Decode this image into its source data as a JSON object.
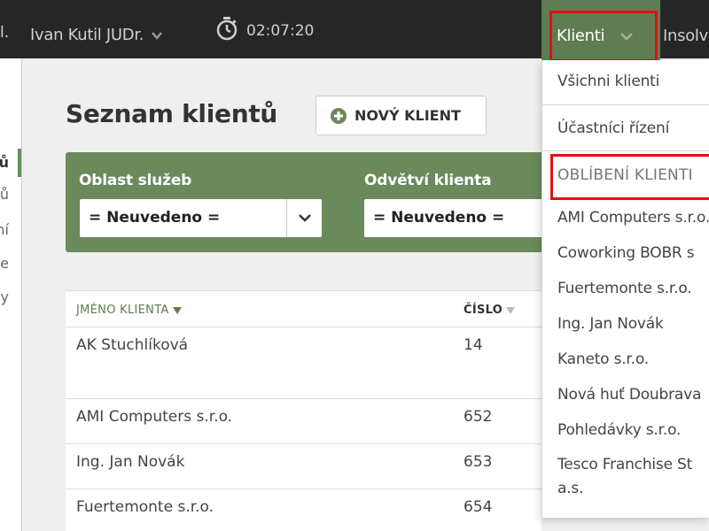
{
  "topbar": {
    "truncated_left": "l.",
    "user_name": "Ivan Kutil JUDr.",
    "timer": "02:07:20",
    "nav_klienti": "Klienti",
    "nav_next": "Insolv"
  },
  "sidebar": {
    "items": [
      "ů",
      "ů",
      "ní",
      "e",
      "y"
    ],
    "active_index": 0
  },
  "main": {
    "title": "Seznam klientů",
    "new_client_button": "NOVÝ KLIENT",
    "filters": [
      {
        "label": "Oblast služeb",
        "value": "= Neuvedeno ="
      },
      {
        "label": "Odvětví klienta",
        "value": "= Neuvedeno ="
      }
    ],
    "table": {
      "columns": [
        "JMÉNO KLIENTA",
        "ČÍSLO"
      ],
      "rows": [
        {
          "name": "AK Stuchlíková",
          "number": "14"
        },
        {
          "name": "AMI Computers s.r.o.",
          "number": "652"
        },
        {
          "name": "Ing. Jan Novák",
          "number": "653"
        },
        {
          "name": "Fuertemonte s.r.o.",
          "number": "654"
        }
      ]
    }
  },
  "dropdown": {
    "items_top": [
      "Všichni klienti",
      "Účastníci řízení"
    ],
    "favorites_header": "OBLÍBENÍ KLIENTI",
    "favorites": [
      "AMI Computers s.r.o.",
      "Coworking BOBR s",
      "Fuertemonte s.r.o.",
      "Ing. Jan Novák",
      "Kaneto s.r.o.",
      "Nová huť Doubrava",
      "Pohledávky s.r.o.",
      "Tesco Franchise St",
      "a.s."
    ]
  },
  "colors": {
    "topbar": "#262626",
    "accent_green": "#6a8a5b",
    "active_nav": "#607c52",
    "highlight_red": "#e01010"
  }
}
